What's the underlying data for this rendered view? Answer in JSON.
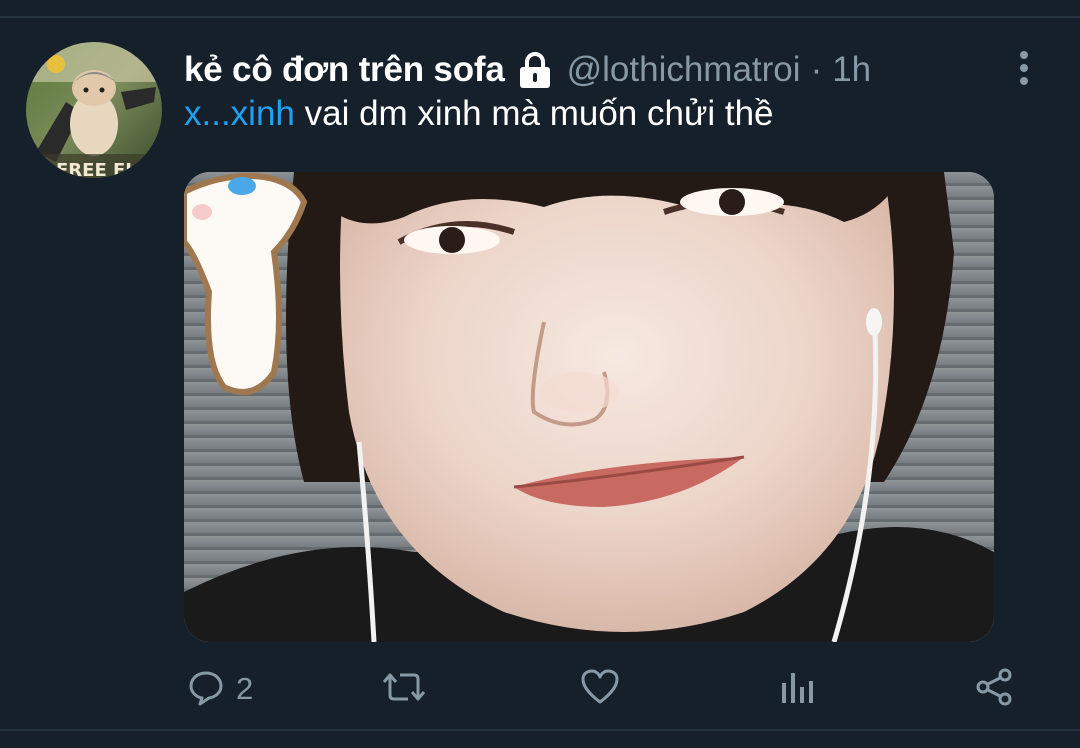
{
  "tweet": {
    "display_name": "kẻ cô đơn trên sofa",
    "handle": "@lothichmatroi",
    "separator": "·",
    "time": "1h",
    "text_mention": "x...xinh",
    "text_body": " vai dm xinh mà muốn chửi thề",
    "avatar_text": "FREE FI"
  },
  "actions": {
    "reply_count": "2"
  },
  "icons": {
    "lock": "lock-icon",
    "more": "more-vertical-icon",
    "reply": "reply-icon",
    "retweet": "retweet-icon",
    "like": "heart-icon",
    "analytics": "analytics-icon",
    "share": "share-icon"
  },
  "colors": {
    "background": "#15202b",
    "accent": "#1da1f2",
    "secondary_text": "#8899a6",
    "divider": "#25333f"
  }
}
